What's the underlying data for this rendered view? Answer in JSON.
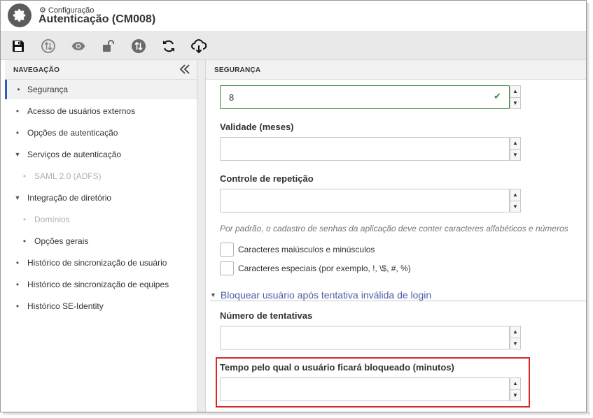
{
  "header": {
    "breadcrumb": "Configuração",
    "title": "Autenticação (CM008)"
  },
  "toolbar": {
    "buttons": [
      {
        "name": "save-button",
        "icon": "floppy-disk-icon"
      },
      {
        "name": "sync-disabled-button",
        "icon": "sync-arrows-icon"
      },
      {
        "name": "view-button",
        "icon": "eye-icon"
      },
      {
        "name": "unlock-button",
        "icon": "unlock-icon"
      },
      {
        "name": "sync-button",
        "icon": "sync-arrows-icon"
      },
      {
        "name": "refresh-button",
        "icon": "refresh-icon"
      },
      {
        "name": "cloud-download-button",
        "icon": "cloud-download-icon"
      }
    ]
  },
  "navigation": {
    "header": "NAVEGAÇÃO",
    "items": [
      {
        "label": "Segurança",
        "type": "bullet",
        "state": "active"
      },
      {
        "label": "Acesso de usuários externos",
        "type": "bullet",
        "state": "normal"
      },
      {
        "label": "Opções de autenticação",
        "type": "bullet",
        "state": "normal"
      },
      {
        "label": "Serviços de autenticação",
        "type": "expanded",
        "state": "normal"
      },
      {
        "label": "SAML 2.0 (ADFS)",
        "type": "sub-bullet",
        "state": "disabled"
      },
      {
        "label": "Integração de diretório",
        "type": "expanded",
        "state": "normal"
      },
      {
        "label": "Domínios",
        "type": "sub-bullet",
        "state": "disabled"
      },
      {
        "label": "Opções gerais",
        "type": "sub-bullet",
        "state": "normal"
      },
      {
        "label": "Histórico de sincronização de usuário",
        "type": "bullet",
        "state": "normal"
      },
      {
        "label": "Histórico de sincronização de equipes",
        "type": "bullet",
        "state": "normal"
      },
      {
        "label": "Histórico SE-Identity",
        "type": "bullet",
        "state": "normal"
      }
    ]
  },
  "main": {
    "header": "SEGURANÇA",
    "min_length": {
      "value": "8"
    },
    "validity": {
      "label": "Validade (meses)",
      "value": ""
    },
    "repetition": {
      "label": "Controle de repetição",
      "value": ""
    },
    "hint": "Por padrão, o cadastro de senhas da aplicação deve conter caracteres alfabéticos e números",
    "checkboxes": [
      {
        "label": "Caracteres maiúsculos e minúsculos",
        "checked": false
      },
      {
        "label": "Caracteres especiais (por exemplo, !, \\$, #, %)",
        "checked": false
      }
    ],
    "lock_section": {
      "title": "Bloquear usuário após tentativa inválida de login",
      "attempts": {
        "label": "Número de tentativas",
        "value": ""
      },
      "lock_time": {
        "label": "Tempo pelo qual o usuário ficará bloqueado (minutos)",
        "value": ""
      }
    }
  },
  "colors": {
    "accent": "#2e5fbf",
    "section_link": "#4a5fa8",
    "valid_border": "#3c8a3c",
    "highlight": "#d62a2a"
  }
}
